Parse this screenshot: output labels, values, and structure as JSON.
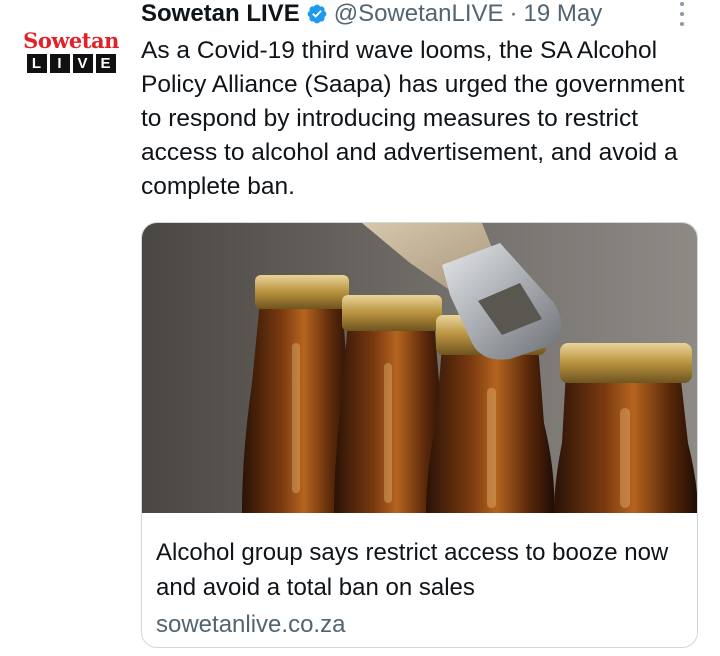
{
  "tweet": {
    "author_name": "Sowetan LIVE",
    "handle": "@SowetanLIVE",
    "separator": "·",
    "date": "19 May",
    "text": "As a Covid-19 third wave looms, the SA Alcohol Policy Alliance (Saapa) has urged the government to respond by introducing measures to restrict access to alcohol and advertisement, and avoid a complete ban.",
    "verified_icon": "verified-badge-icon",
    "more_icon": "more-vertical-icon"
  },
  "avatar": {
    "brand_top": "Sowetan",
    "brand_letters": [
      "L",
      "I",
      "V",
      "E"
    ],
    "brand_color": "#e0232a"
  },
  "card": {
    "title": "Alcohol group says restrict access to booze now and avoid a total ban on sales",
    "domain": "sowetanlive.co.za",
    "image_icon": "beer-bottles-photo"
  },
  "colors": {
    "text_primary": "#0f1419",
    "text_secondary": "#536471",
    "verified_blue": "#1d9bf0",
    "card_border": "#cfd9de"
  }
}
